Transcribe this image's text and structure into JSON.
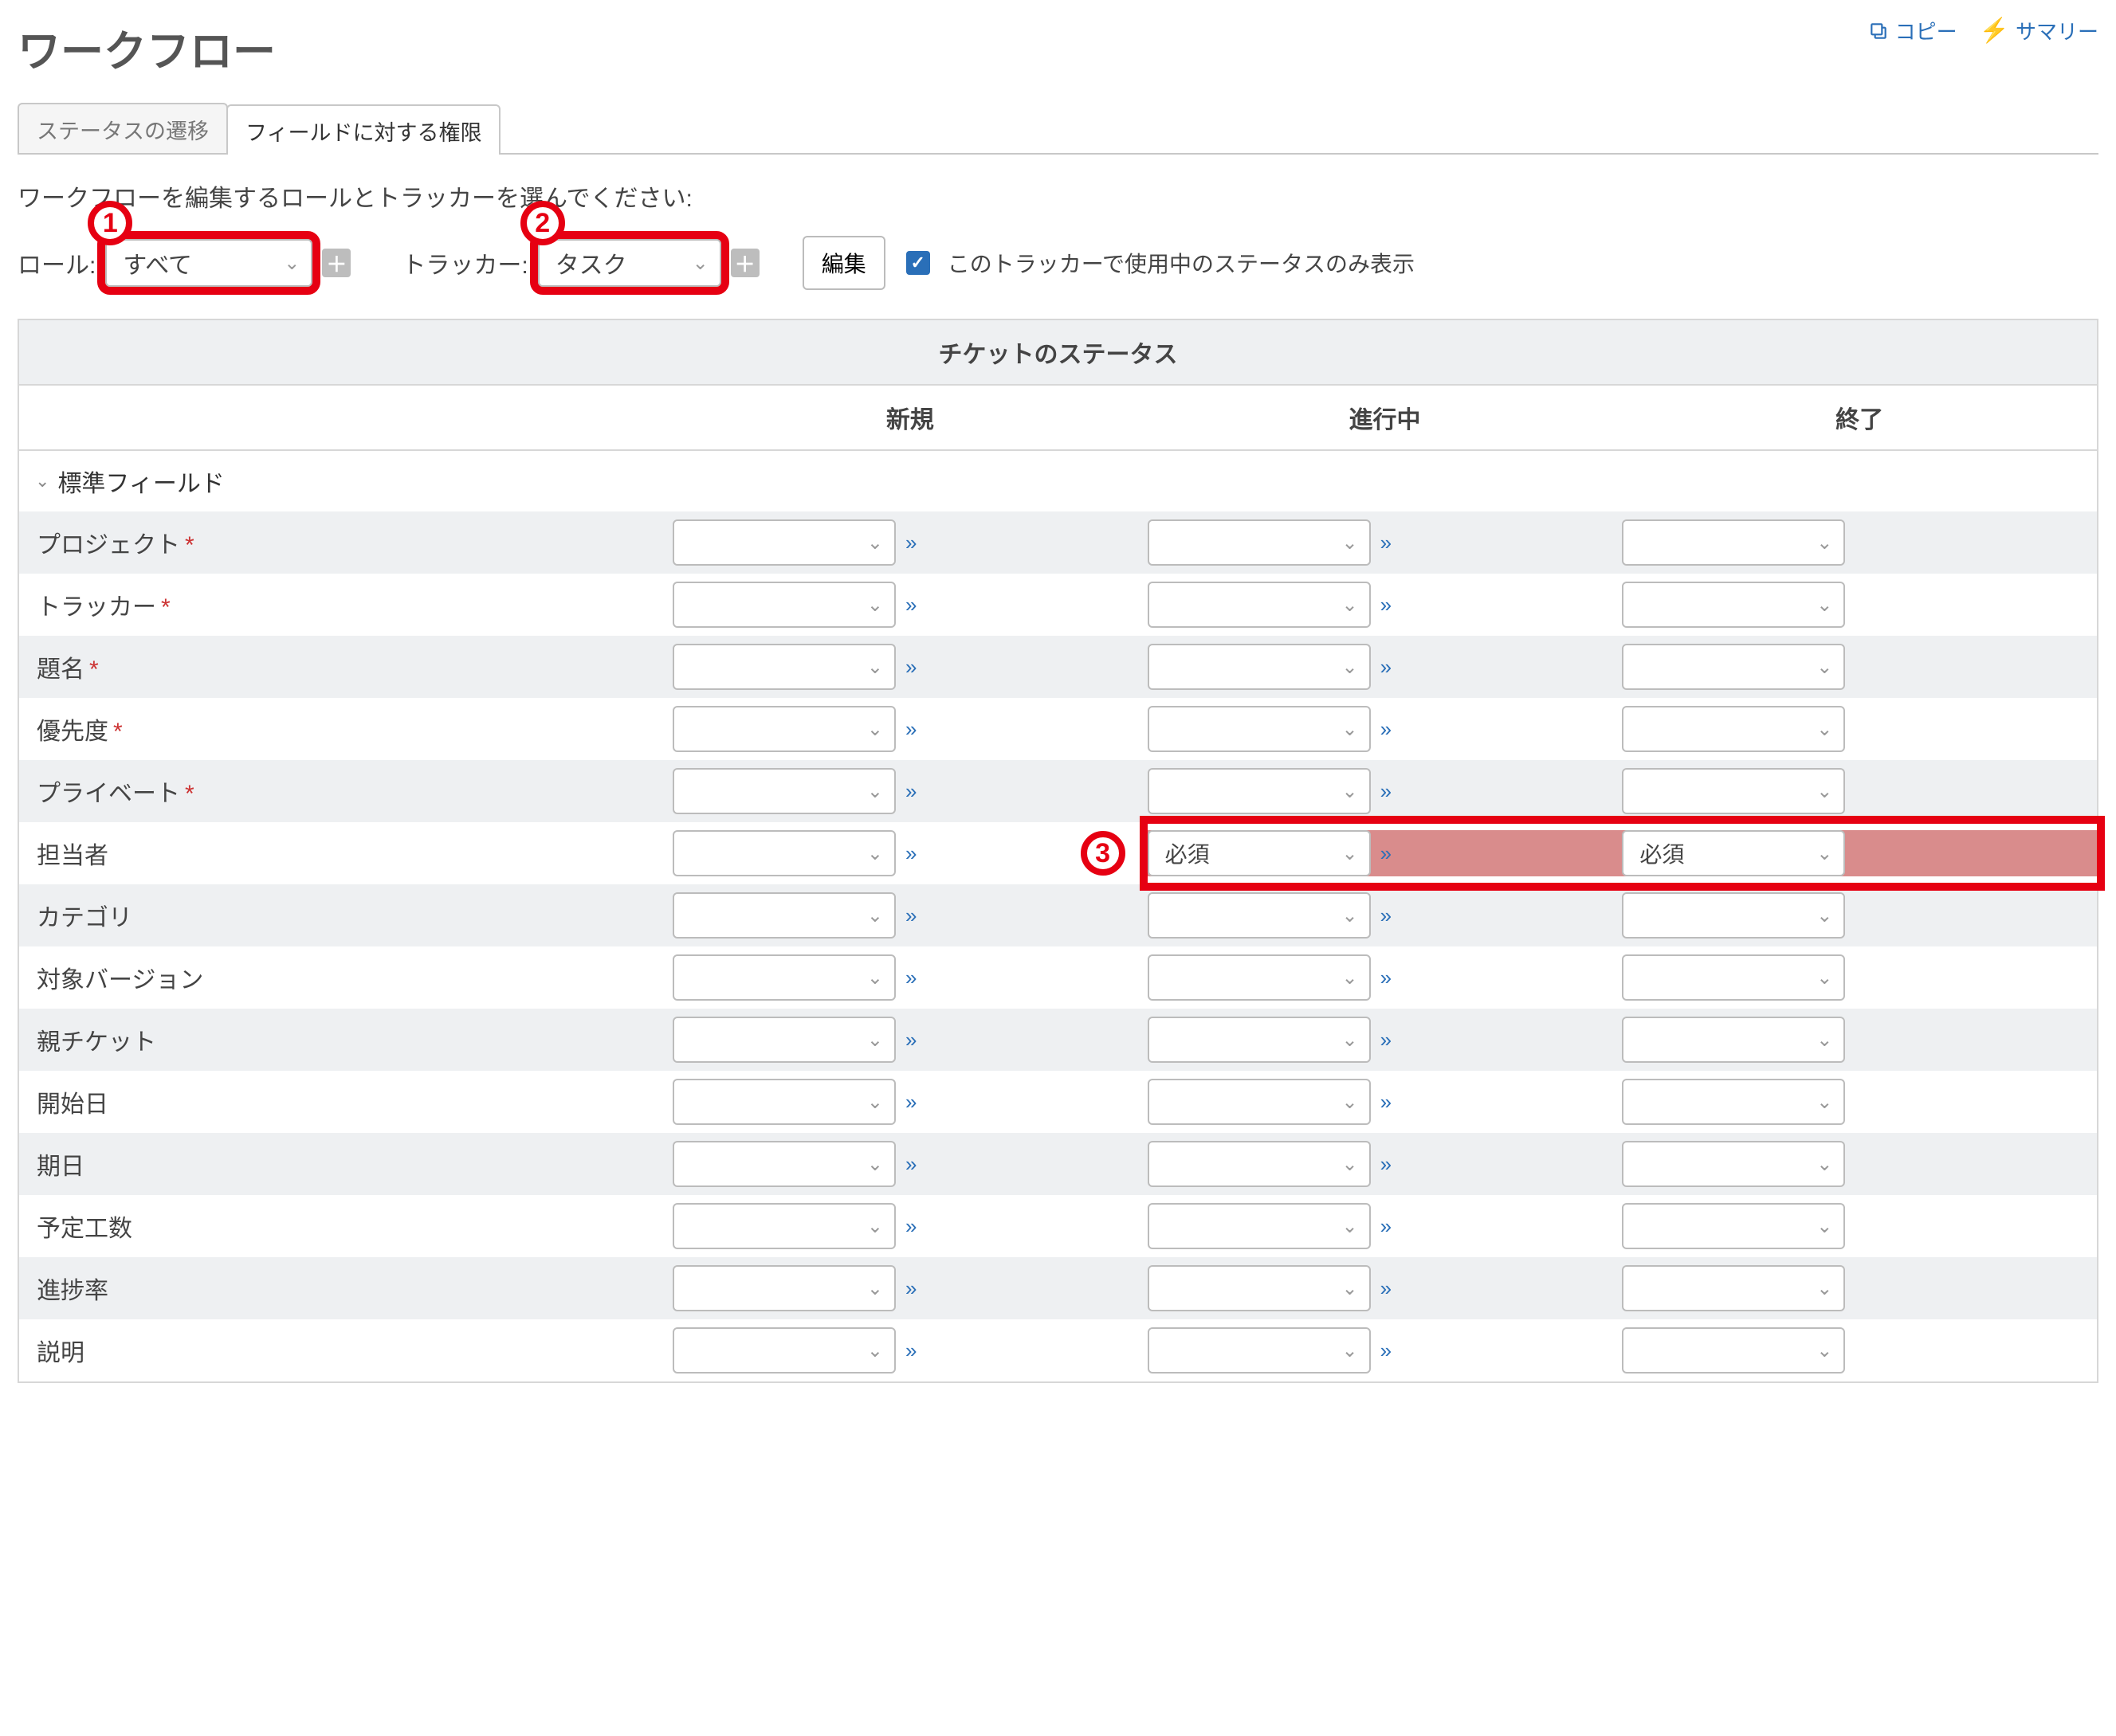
{
  "header": {
    "title": "ワークフロー",
    "links": {
      "copy": "コピー",
      "summary": "サマリー"
    }
  },
  "tabs": {
    "status": "ステータスの遷移",
    "fields": "フィールドに対する権限"
  },
  "instruction": "ワークフローを編集するロールとトラッカーを選んでください:",
  "filters": {
    "role_label": "ロール:",
    "role_value": "すべて",
    "tracker_label": "トラッカー:",
    "tracker_value": "タスク",
    "edit": "編集",
    "only_used": "このトラッカーで使用中のステータスのみ表示"
  },
  "callouts": {
    "c1": "1",
    "c2": "2",
    "c3": "3"
  },
  "table": {
    "super_header": "チケットのステータス",
    "columns": [
      "新規",
      "進行中",
      "終了"
    ],
    "section": "標準フィールド",
    "rows": [
      {
        "name": "プロジェクト",
        "required": true,
        "cells": [
          "",
          "",
          ""
        ]
      },
      {
        "name": "トラッカー",
        "required": true,
        "cells": [
          "",
          "",
          ""
        ]
      },
      {
        "name": "題名",
        "required": true,
        "cells": [
          "",
          "",
          ""
        ]
      },
      {
        "name": "優先度",
        "required": true,
        "cells": [
          "",
          "",
          ""
        ]
      },
      {
        "name": "プライベート",
        "required": true,
        "cells": [
          "",
          "",
          ""
        ]
      },
      {
        "name": "担当者",
        "required": false,
        "cells": [
          "",
          "必須",
          "必須"
        ],
        "highlight": [
          1,
          2
        ]
      },
      {
        "name": "カテゴリ",
        "required": false,
        "cells": [
          "",
          "",
          ""
        ]
      },
      {
        "name": "対象バージョン",
        "required": false,
        "cells": [
          "",
          "",
          ""
        ]
      },
      {
        "name": "親チケット",
        "required": false,
        "cells": [
          "",
          "",
          ""
        ]
      },
      {
        "name": "開始日",
        "required": false,
        "cells": [
          "",
          "",
          ""
        ]
      },
      {
        "name": "期日",
        "required": false,
        "cells": [
          "",
          "",
          ""
        ]
      },
      {
        "name": "予定工数",
        "required": false,
        "cells": [
          "",
          "",
          ""
        ]
      },
      {
        "name": "進捗率",
        "required": false,
        "cells": [
          "",
          "",
          ""
        ]
      },
      {
        "name": "説明",
        "required": false,
        "cells": [
          "",
          "",
          ""
        ]
      }
    ]
  }
}
